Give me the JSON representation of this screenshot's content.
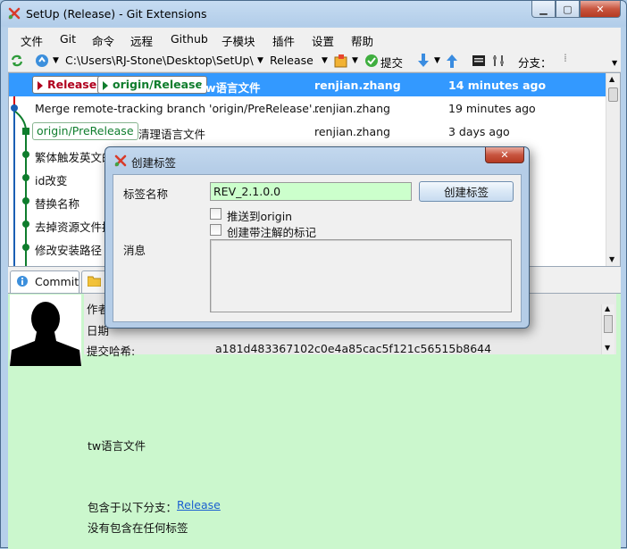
{
  "window": {
    "title": "SetUp (Release) - Git Extensions",
    "min": "▁",
    "max": "▢",
    "close": "✕"
  },
  "menu": [
    "文件",
    "Git",
    "命令",
    "远程",
    "Github",
    "子模块",
    "插件",
    "设置",
    "帮助"
  ],
  "toolbar": {
    "path": "C:\\Users\\RJ-Stone\\Desktop\\SetUp\\",
    "branch": "Release",
    "commit": "提交",
    "branch_label": "分支："
  },
  "grid": {
    "rows": [
      {
        "refs": [
          {
            "label": "Release",
            "style": "red"
          },
          {
            "label": "origin/Release",
            "style": "green"
          }
        ],
        "message": "tw语言文件",
        "author": "renjian.zhang",
        "date": "14 minutes ago",
        "selected": true
      },
      {
        "refs": [],
        "message": "Merge remote-tracking branch 'origin/PreRelease'...",
        "author": "renjian.zhang",
        "date": "19 minutes ago"
      },
      {
        "refs": [
          {
            "label": "origin/PreRelease",
            "style": "plain"
          }
        ],
        "message": "清理语言文件",
        "author": "renjian.zhang",
        "date": "3 days ago"
      },
      {
        "refs": [],
        "message": "繁体触发英文的",
        "author": "",
        "date": ""
      },
      {
        "refs": [],
        "message": "id改变",
        "author": "",
        "date": ""
      },
      {
        "refs": [],
        "message": "替换名称",
        "author": "",
        "date": ""
      },
      {
        "refs": [],
        "message": "去掉资源文件拷",
        "author": "",
        "date": ""
      },
      {
        "refs": [],
        "message": "修改安装路径",
        "author": "",
        "date": ""
      }
    ]
  },
  "tabs": {
    "commit": "Commit"
  },
  "commit": {
    "author_label": "作者",
    "date_label": "日期",
    "hash_label": "提交哈希:",
    "hash": "a181d483367102c0e4a85cac5f121c56515b8644",
    "message": "tw语言文件",
    "branches_label": "包含于以下分支：",
    "branch_link": "Release",
    "no_tags": "没有包含在任何标签"
  },
  "dialog": {
    "title": "创建标签",
    "name_label": "标签名称",
    "name_value": "REV_2.1.0.0",
    "create_button": "创建标签",
    "push_label": "推送到origin",
    "annotated_label": "创建带注解的标记",
    "message_label": "消息",
    "close": "✕"
  },
  "colors": {
    "selected_row": "#3399ff",
    "panel_green": "#cbf7cd",
    "input_green": "#ccffcc",
    "graph_red": "#d80000",
    "graph_blue": "#1a5fb4",
    "graph_green": "#0f7d2d"
  }
}
